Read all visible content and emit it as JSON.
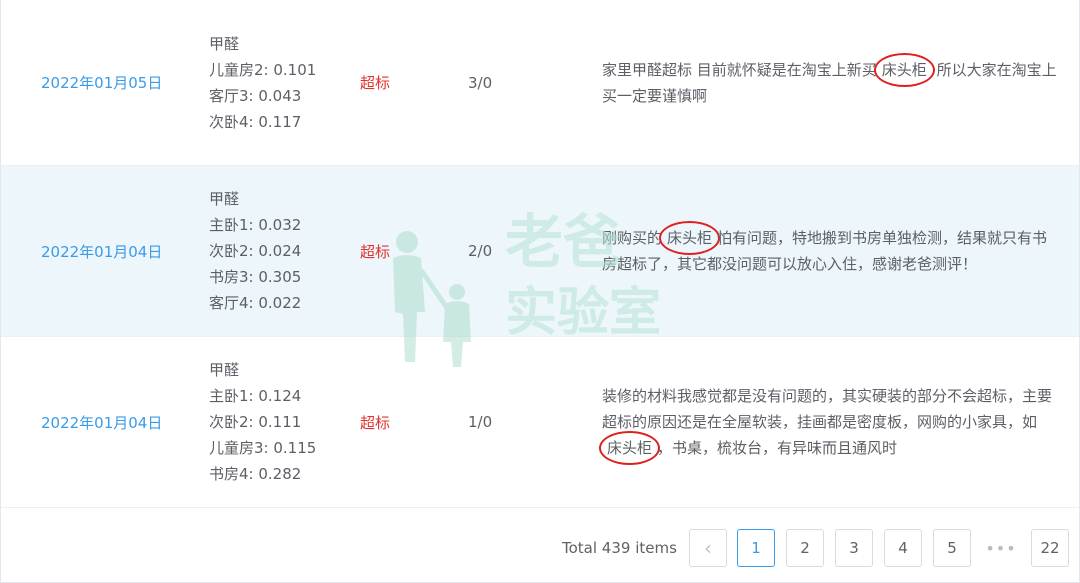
{
  "table": {
    "rows": [
      {
        "date": "2022年01月05日",
        "pollutant": "甲醛",
        "readings": [
          "儿童房2: 0.101",
          "客厅3: 0.043",
          "次卧4: 0.117"
        ],
        "status": "超标",
        "ratio": "3/0",
        "comment_before": "家里甲醛超标 目前就怀疑是在淘宝上新买",
        "comment_mark": "床头柜",
        "comment_after": " 所以大家在淘宝上买一定要谨慎啊"
      },
      {
        "date": "2022年01月04日",
        "pollutant": "甲醛",
        "readings": [
          "主卧1: 0.032",
          "次卧2: 0.024",
          "书房3: 0.305",
          "客厅4: 0.022"
        ],
        "status": "超标",
        "ratio": "2/0",
        "comment_before": "刚购买的",
        "comment_mark": "床头柜",
        "comment_after": "怕有问题，特地搬到书房单独检测，结果就只有书房超标了，其它都没问题可以放心入住，感谢老爸测评！"
      },
      {
        "date": "2022年01月04日",
        "pollutant": "甲醛",
        "readings": [
          "主卧1: 0.124",
          "次卧2: 0.111",
          "儿童房3: 0.115",
          "书房4: 0.282"
        ],
        "status": "超标",
        "ratio": "1/0",
        "comment_before": "装修的材料我感觉都是没有问题的，其实硬装的部分不会超标，主要超标的原因还是在全屋软装，挂画都是密度板，网购的小家具，如",
        "comment_mark": "床头柜",
        "comment_after": "，书桌，梳妆台，有异味而且通风时"
      }
    ]
  },
  "watermark": {
    "line1": "老爸",
    "line2": "实验室"
  },
  "pagination": {
    "total": "Total 439 items",
    "prev": "‹",
    "pages": [
      "1",
      "2",
      "3",
      "4",
      "5"
    ],
    "current": "1",
    "ellipsis": "•••",
    "last": "22"
  },
  "colors": {
    "link": "#3a9be8",
    "danger": "#e3332f",
    "highlight_row": "#ecf6fb",
    "annotation": "#e0201f"
  }
}
